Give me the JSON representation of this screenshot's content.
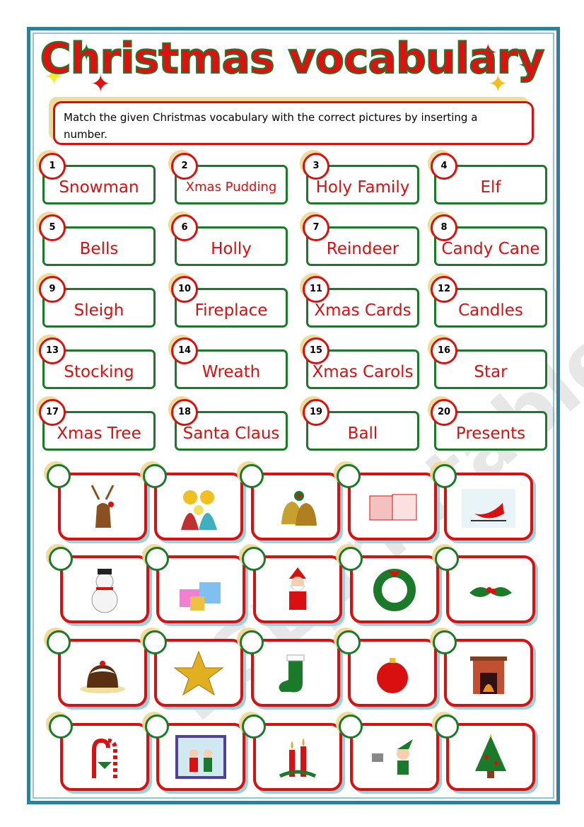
{
  "title": "Christmas vocabulary",
  "instruction": "Match the given Christmas vocabulary with the correct pictures by inserting a number.",
  "watermark": "ESLprintables.com",
  "colors": {
    "border": "#2f7f9a",
    "red": "#d81010",
    "green": "#1a7a2a",
    "shadow": "#f0dc9a"
  },
  "words": [
    {
      "n": "1",
      "w": "Snowman"
    },
    {
      "n": "2",
      "w": "Xmas Pudding"
    },
    {
      "n": "3",
      "w": "Holy Family"
    },
    {
      "n": "4",
      "w": "Elf"
    },
    {
      "n": "5",
      "w": "Bells"
    },
    {
      "n": "6",
      "w": "Holly"
    },
    {
      "n": "7",
      "w": "Reindeer"
    },
    {
      "n": "8",
      "w": "Candy Cane"
    },
    {
      "n": "9",
      "w": "Sleigh"
    },
    {
      "n": "10",
      "w": "Fireplace"
    },
    {
      "n": "11",
      "w": "Xmas Cards"
    },
    {
      "n": "12",
      "w": "Candles"
    },
    {
      "n": "13",
      "w": "Stocking"
    },
    {
      "n": "14",
      "w": "Wreath"
    },
    {
      "n": "15",
      "w": "Xmas Carols"
    },
    {
      "n": "16",
      "w": "Star"
    },
    {
      "n": "17",
      "w": "Xmas Tree"
    },
    {
      "n": "18",
      "w": "Santa Claus"
    },
    {
      "n": "19",
      "w": "Ball"
    },
    {
      "n": "20",
      "w": "Presents"
    }
  ],
  "pictures": [
    "reindeer-icon",
    "holy-family-icon",
    "bells-icon",
    "xmas-cards-icon",
    "sleigh-icon",
    "snowman-icon",
    "presents-icon",
    "santa-claus-icon",
    "wreath-icon",
    "holly-icon",
    "xmas-pudding-icon",
    "star-icon",
    "stocking-icon",
    "ball-icon",
    "fireplace-icon",
    "candy-cane-icon",
    "xmas-carols-icon",
    "candles-icon",
    "elf-icon",
    "xmas-tree-icon"
  ]
}
